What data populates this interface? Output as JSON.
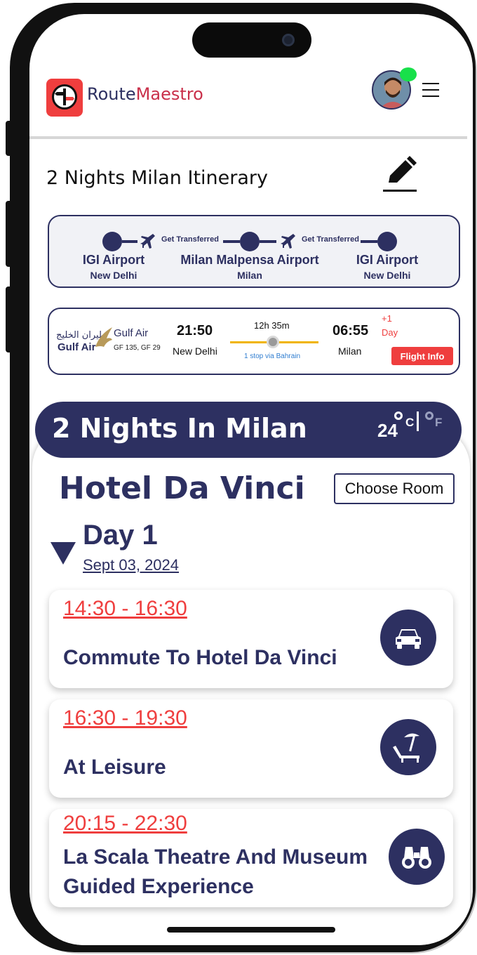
{
  "header": {
    "brand_part1": "Route",
    "brand_part2": "Maestro",
    "menu_icon": "hamburger-icon",
    "edit_icon": "pencil-icon"
  },
  "page": {
    "title": "2 Nights Milan Itinerary"
  },
  "route": {
    "stops": [
      {
        "name": "IGI Airport",
        "city": "New Delhi"
      },
      {
        "name": "Milan Malpensa Airport",
        "city": "Milan"
      },
      {
        "name": "IGI Airport",
        "city": "New Delhi"
      }
    ],
    "transfers": [
      "Get Transferred",
      "Get Transferred"
    ]
  },
  "flight": {
    "airline_logo_arabic": "طيران الخليج",
    "airline_logo_text": "Gulf Air",
    "airline": "Gulf Air",
    "flight_numbers": "GF 135, GF 29",
    "dep_time": "21:50",
    "dep_city": "New Delhi",
    "duration": "12h 35m",
    "stops": "1 stop via Bahrain",
    "arr_time": "06:55",
    "arr_city": "Milan",
    "plus_days": "+1",
    "plus_days_unit": "Day",
    "info_button": "Flight Info"
  },
  "stay": {
    "title": "2 Nights In Milan",
    "temperature": "24",
    "unit_c": "C",
    "unit_f": "F",
    "hotel": "Hotel Da Vinci",
    "choose_room": "Choose Room"
  },
  "day": {
    "label": "Day 1",
    "date": "Sept 03, 2024"
  },
  "activities": [
    {
      "time": "14:30 - 16:30",
      "title": "Commute To Hotel Da Vinci",
      "icon": "car-icon"
    },
    {
      "time": "16:30 - 19:30",
      "title": "At Leisure",
      "icon": "beach-chair-icon"
    },
    {
      "time": "20:15 - 22:30",
      "title": "La Scala Theatre And Museum Guided Experience",
      "icon": "binoculars-icon"
    }
  ],
  "colors": {
    "primary": "#2d3061",
    "accent": "#ef3e3e",
    "online": "#18e04a",
    "duration_line": "#f0b400"
  }
}
